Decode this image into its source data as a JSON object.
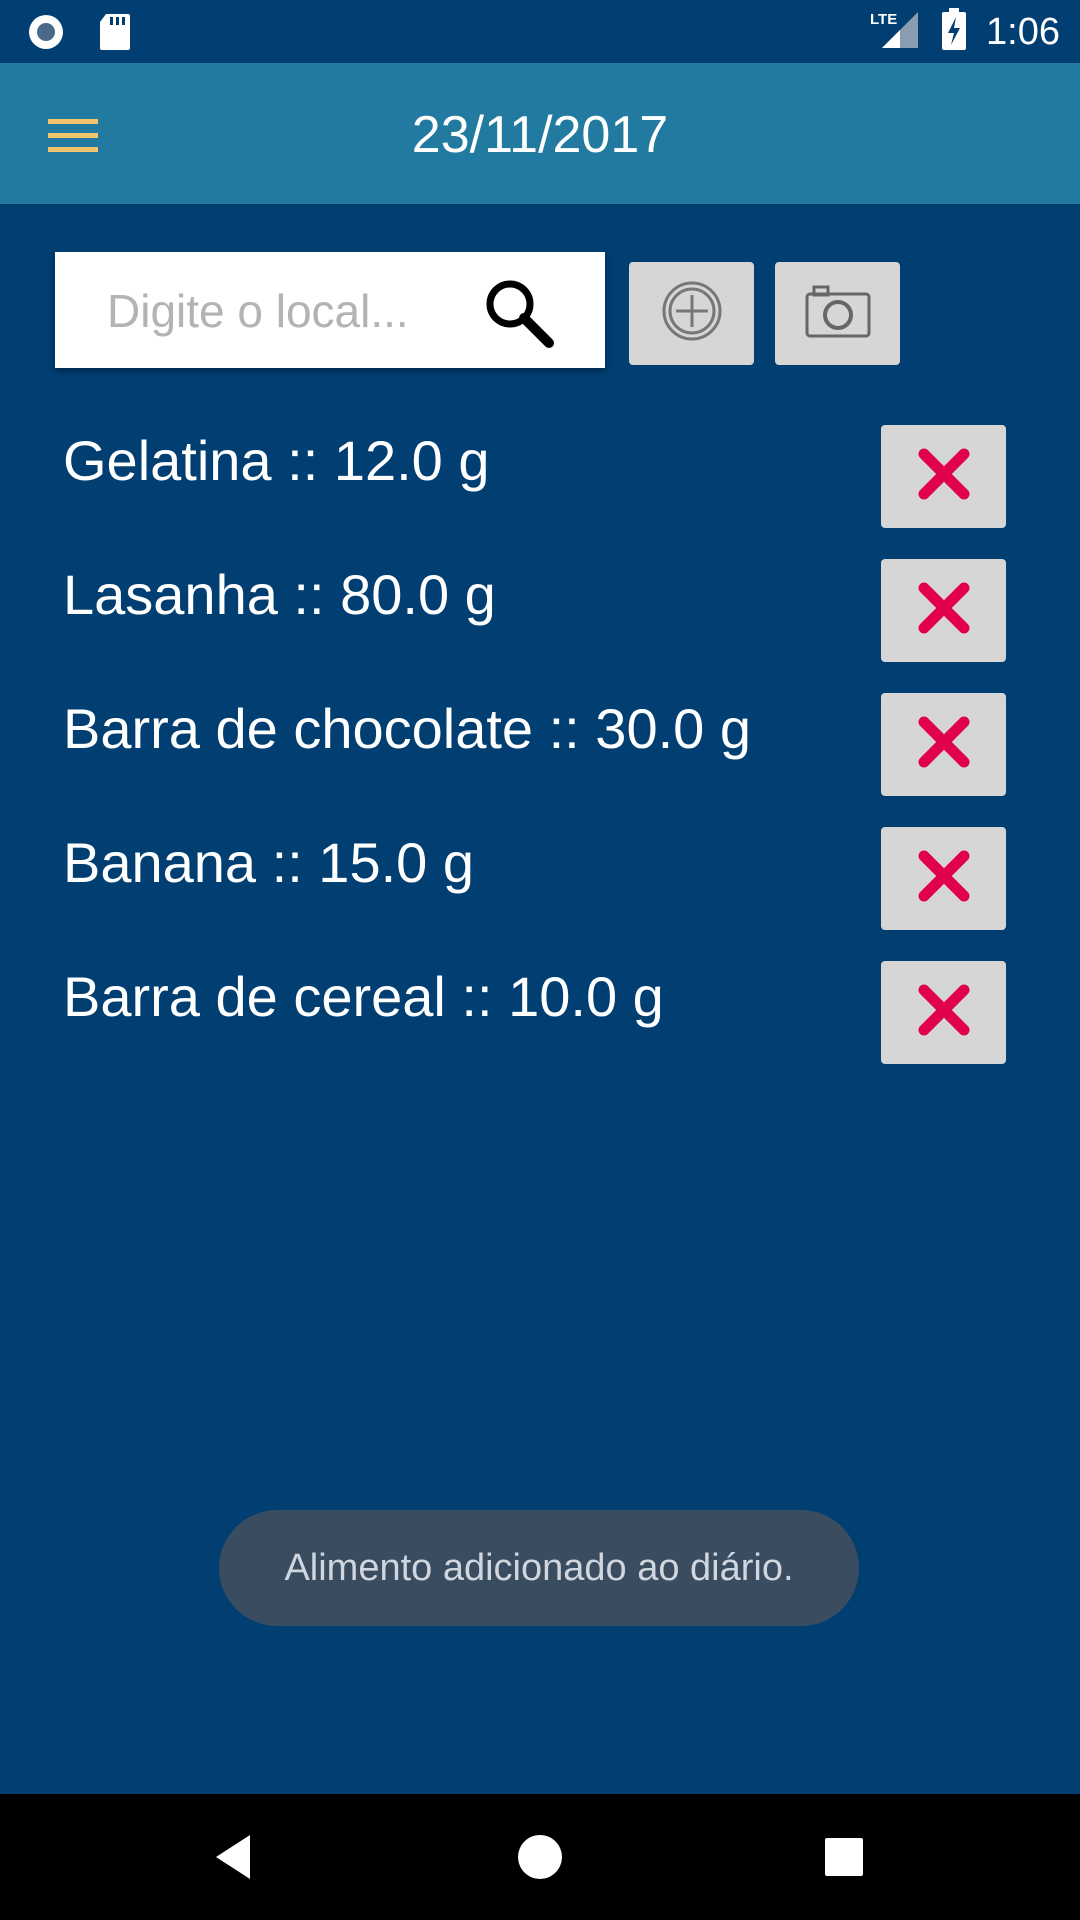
{
  "status_bar": {
    "time": "1:06",
    "network": "LTE",
    "icons": [
      "circle-app-icon",
      "sd-card-icon",
      "lte-signal-icon",
      "battery-charging-icon"
    ]
  },
  "app_bar": {
    "title": "23/11/2017",
    "menu_icon": "hamburger-menu-icon",
    "accent": "#227aa0"
  },
  "search": {
    "placeholder": "Digite o local...",
    "value": ""
  },
  "toolbar": {
    "add_icon": "plus-circle-icon",
    "camera_icon": "camera-icon"
  },
  "items": [
    {
      "label": "Gelatina :: 12.0 g"
    },
    {
      "label": "Lasanha :: 80.0 g"
    },
    {
      "label": "Barra de chocolate :: 30.0 g"
    },
    {
      "label": "Banana :: 15.0 g"
    },
    {
      "label": "Barra de cereal :: 10.0 g"
    }
  ],
  "delete_icon": "red-x-icon",
  "toast": {
    "message": "Alimento adicionado ao diário."
  },
  "nav_bar": {
    "buttons": [
      "back-icon",
      "home-icon",
      "recents-icon"
    ]
  },
  "colors": {
    "background": "#013e71",
    "delete_x": "#e0004d"
  }
}
